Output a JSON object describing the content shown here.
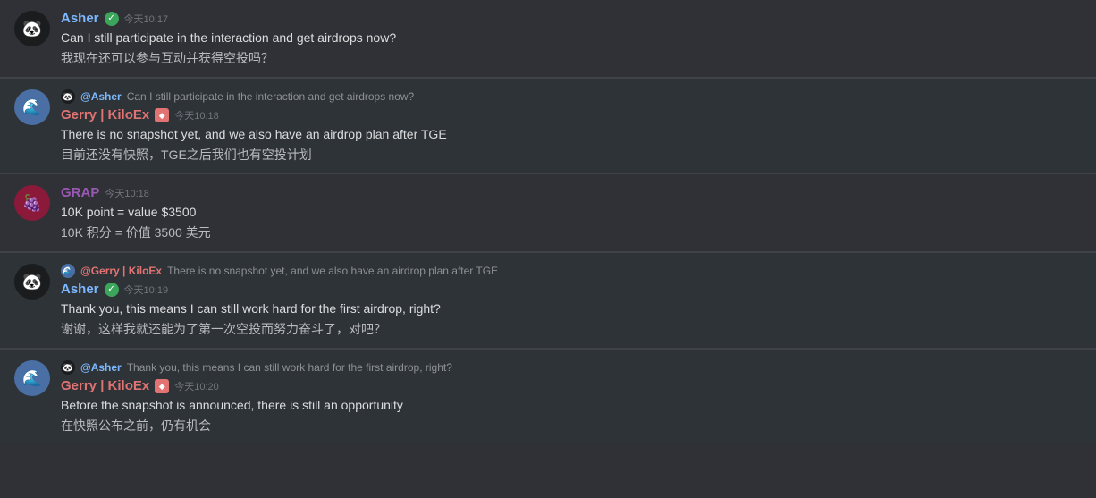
{
  "messages": [
    {
      "id": "msg1",
      "type": "normal",
      "username": "Asher",
      "usernameClass": "username-asher",
      "badge": "verified",
      "timestamp": "今天10:17",
      "avatarEmoji": "🐼",
      "avatarClass": "avatar-asher",
      "text1": "Can I still participate in the interaction and get airdrops now?",
      "text2": "我现在还可以参与互动并获得空投吗？"
    },
    {
      "id": "msg2",
      "type": "reply",
      "replyTo": "@Asher",
      "replyToClass": "reply-at",
      "replyText": "Can I still participate in the interaction and get airdrops now?",
      "replyAvatarEmoji": "🐼",
      "replyAvatarClass": "reply-preview-avatar-asher",
      "username": "Gerry | KiloEx",
      "usernameClass": "username-gerry",
      "badge": "kiloe",
      "timestamp": "今天10:18",
      "avatarEmoji": "🌊",
      "avatarClass": "avatar-gerry",
      "text1": "There is no snapshot yet, and we also have an airdrop plan after TGE",
      "text2": "目前还没有快照，TGE之后我们也有空投计划"
    },
    {
      "id": "msg3",
      "type": "normal",
      "username": "GRAP",
      "usernameClass": "username-grap",
      "badge": "none",
      "timestamp": "今天10:18",
      "avatarEmoji": "🍇",
      "avatarClass": "avatar-grap",
      "text1": "10K point = value $3500",
      "text2": "10K 积分 = 价值 3500 美元"
    },
    {
      "id": "msg4",
      "type": "reply",
      "replyTo": "@Gerry | KiloEx",
      "replyToClass": "reply-at-gerry",
      "replyText": "There is no snapshot yet, and we also have an airdrop plan after TGE",
      "replyAvatarEmoji": "🌊",
      "replyAvatarClass": "reply-preview-avatar-gerry",
      "username": "Asher",
      "usernameClass": "username-asher",
      "badge": "verified",
      "timestamp": "今天10:19",
      "avatarEmoji": "🐼",
      "avatarClass": "avatar-asher",
      "text1": "Thank you, this means I can still work hard for the first airdrop, right?",
      "text2": "谢谢，这样我就还能为了第一次空投而努力奋斗了，对吧？"
    },
    {
      "id": "msg5",
      "type": "reply",
      "replyTo": "@Asher",
      "replyToClass": "reply-at",
      "replyText": "Thank you, this means I can still work hard for the first airdrop, right?",
      "replyAvatarEmoji": "🐼",
      "replyAvatarClass": "reply-preview-avatar-asher",
      "username": "Gerry | KiloEx",
      "usernameClass": "username-gerry",
      "badge": "kiloe",
      "timestamp": "今天10:20",
      "avatarEmoji": "🌊",
      "avatarClass": "avatar-gerry",
      "text1": "Before the snapshot is announced, there is still an opportunity",
      "text2": "在快照公布之前，仍有机会"
    }
  ],
  "badges": {
    "verified_symbol": "✓",
    "kiloe_symbol": "◆"
  }
}
